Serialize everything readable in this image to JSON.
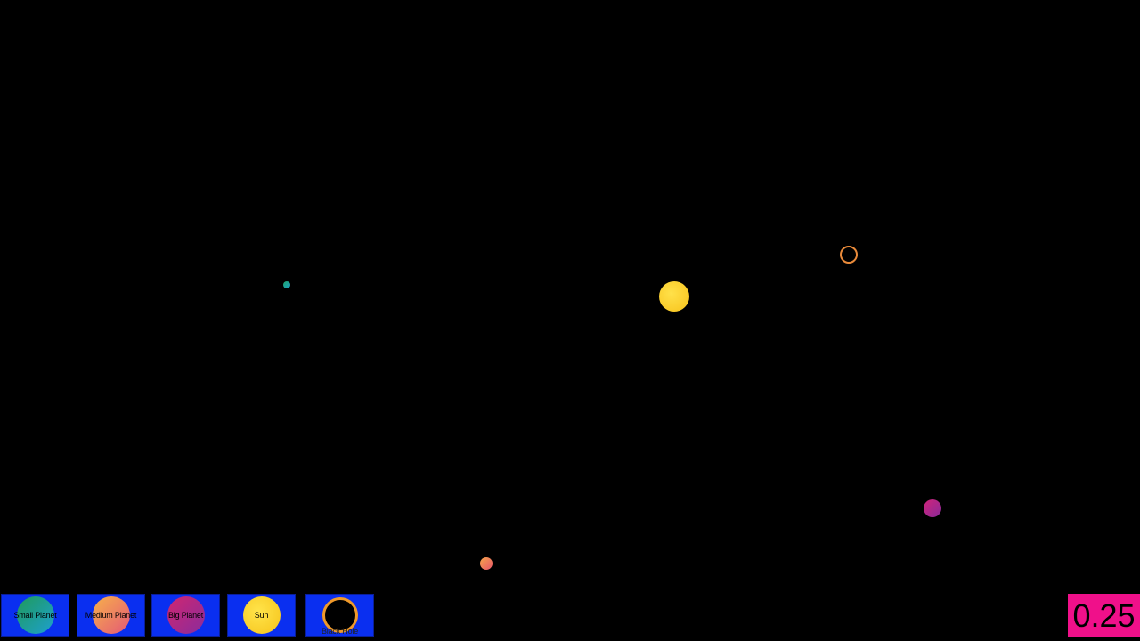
{
  "toolbar": {
    "buttons": [
      {
        "label": "Small Planet",
        "icon": "small-planet-icon"
      },
      {
        "label": "Medium Planet",
        "icon": "medium-planet-icon"
      },
      {
        "label": "Big Planet",
        "icon": "big-planet-icon"
      },
      {
        "label": "Sun",
        "icon": "sun-icon"
      },
      {
        "label": "Black Hole",
        "icon": "black-hole-icon"
      }
    ],
    "button_color": "#0a2ff0"
  },
  "speed": {
    "value": "0.25",
    "background": "#f0108a"
  },
  "space": {
    "background": "#000000",
    "objects": [
      "small-planet",
      "sun",
      "black-hole",
      "big-planet",
      "medium-planet"
    ]
  }
}
